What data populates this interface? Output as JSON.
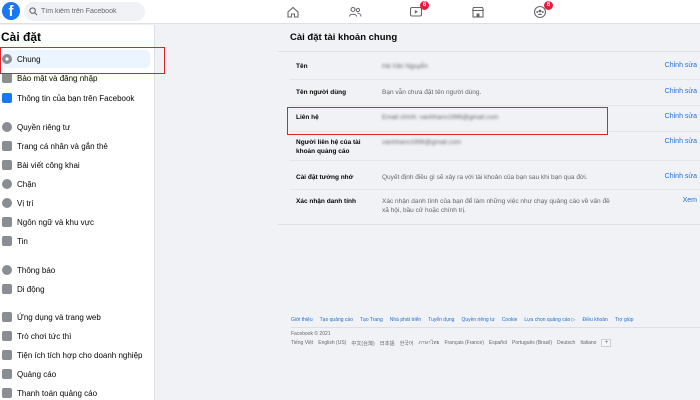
{
  "topbar": {
    "logo": "f",
    "search_placeholder": "Tìm kiếm trên Facebook",
    "nav": [
      {
        "name": "home-icon",
        "badge": ""
      },
      {
        "name": "friends-icon",
        "badge": ""
      },
      {
        "name": "watch-icon",
        "badge": "6"
      },
      {
        "name": "marketplace-icon",
        "badge": ""
      },
      {
        "name": "groups-icon",
        "badge": "6"
      }
    ]
  },
  "sidebar": {
    "title": "Cài đặt",
    "items": [
      {
        "label": "Chung",
        "icon": "gear-icon",
        "active": true
      },
      {
        "label": "Bảo mật và đăng nhập",
        "icon": "shield-icon"
      },
      {
        "label": "Thông tin của bạn trên Facebook",
        "icon": "facebook-info-icon"
      },
      {
        "label": "Quyền riêng tư",
        "icon": "privacy-lock-icon"
      },
      {
        "label": "Trang cá nhân và gắn thẻ",
        "icon": "profile-tag-icon"
      },
      {
        "label": "Bài viết công khai",
        "icon": "globe-icon"
      },
      {
        "label": "Chặn",
        "icon": "block-user-icon"
      },
      {
        "label": "Vị trí",
        "icon": "location-pin-icon"
      },
      {
        "label": "Ngôn ngữ và khu vực",
        "icon": "language-icon"
      },
      {
        "label": "Tin",
        "icon": "stories-icon"
      },
      {
        "label": "Thông báo",
        "icon": "bell-icon"
      },
      {
        "label": "Di động",
        "icon": "mobile-icon"
      },
      {
        "label": "Ứng dụng và trang web",
        "icon": "apps-icon"
      },
      {
        "label": "Trò chơi tức thì",
        "icon": "game-icon"
      },
      {
        "label": "Tiện ích tích hợp cho doanh nghiệp",
        "icon": "business-integrations-icon"
      },
      {
        "label": "Quảng cáo",
        "icon": "ads-icon"
      },
      {
        "label": "Thanh toán quảng cáo",
        "icon": "ads-payment-icon"
      }
    ]
  },
  "main": {
    "title": "Cài đặt tài khoản chung",
    "rows": [
      {
        "label": "Tên",
        "value": "Hà Vân Nguyễn",
        "action": "Chỉnh sửa",
        "blurred": true
      },
      {
        "label": "Tên người dùng",
        "value": "Bạn vẫn chưa đặt tên người dùng.",
        "action": "Chỉnh sửa"
      },
      {
        "label": "Liên hệ",
        "value": "Email chính: vanhhanv1996@gmail.com",
        "action": "Chỉnh sửa",
        "blurred": true
      },
      {
        "label": "Người liên hệ của tài khoản quảng cáo",
        "value": "vanhhanv1996@gmail.com",
        "action": "Chỉnh sửa",
        "blurred": true
      },
      {
        "label": "Cài đặt tưởng nhớ",
        "value": "Quyết định điều gì sẽ xảy ra với tài khoản của bạn sau khi bạn qua đời.",
        "action": "Chỉnh sửa"
      },
      {
        "label": "Xác nhận danh tính",
        "value": "Xác nhận danh tính của bạn để làm những việc như chạy quảng cáo về vấn đề xã hội, bầu cử hoặc chính trị.",
        "action": "Xem"
      }
    ]
  },
  "footer": {
    "links": [
      "Giới thiệu",
      "Tạo quảng cáo",
      "Tạo Trang",
      "Nhà phát triển",
      "Tuyển dụng",
      "Quyền riêng tư",
      "Cookie",
      "Lựa chọn quảng cáo ▷",
      "Điều khoản",
      "Trợ giúp"
    ],
    "copyright": "Facebook © 2021",
    "languages": [
      "Tiếng Việt",
      "English (US)",
      "中文(台灣)",
      "日本語",
      "한국어",
      "ภาษาไทย",
      "Français (France)",
      "Español",
      "Português (Brasil)",
      "Deutsch",
      "Italiano"
    ],
    "more_button": "+"
  },
  "colors": {
    "brand": "#1877f2",
    "link": "#216fdb",
    "highlight_box": "#e0202a",
    "badge": "#e41e3f"
  }
}
